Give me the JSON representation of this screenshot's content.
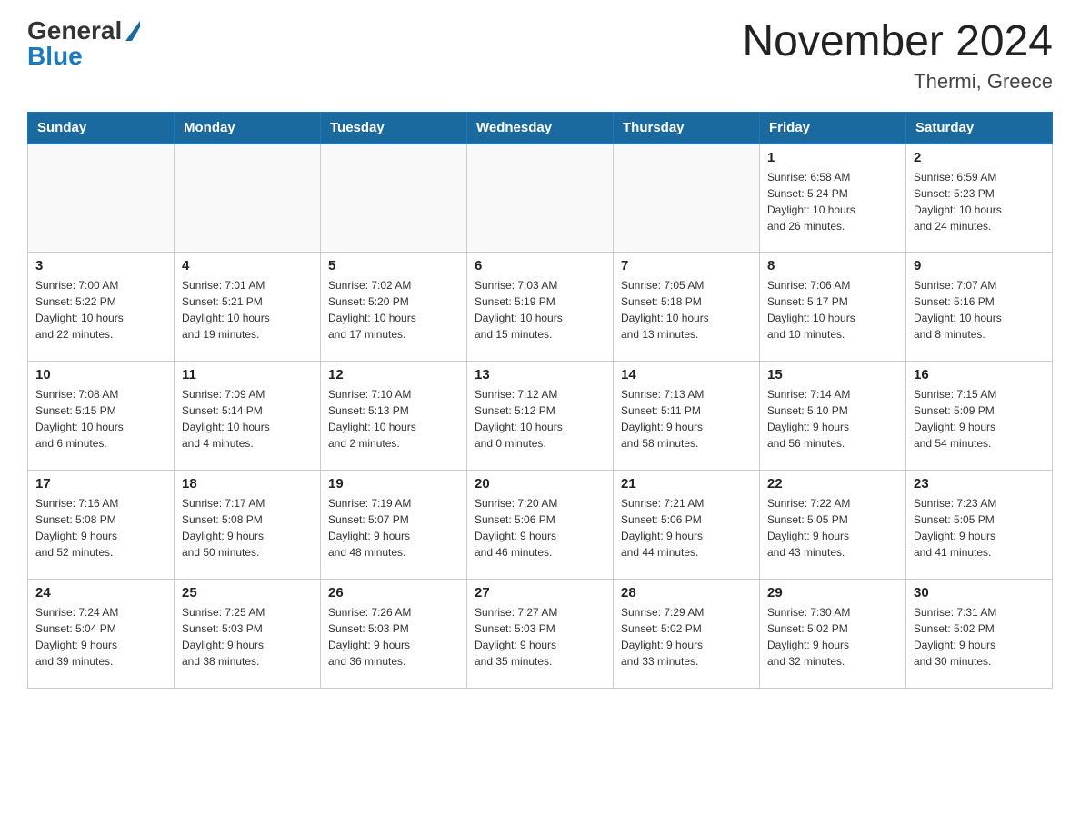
{
  "header": {
    "logo_general": "General",
    "logo_blue": "Blue",
    "month_title": "November 2024",
    "location": "Thermi, Greece"
  },
  "weekdays": [
    "Sunday",
    "Monday",
    "Tuesday",
    "Wednesday",
    "Thursday",
    "Friday",
    "Saturday"
  ],
  "weeks": [
    {
      "days": [
        {
          "num": "",
          "info": ""
        },
        {
          "num": "",
          "info": ""
        },
        {
          "num": "",
          "info": ""
        },
        {
          "num": "",
          "info": ""
        },
        {
          "num": "",
          "info": ""
        },
        {
          "num": "1",
          "info": "Sunrise: 6:58 AM\nSunset: 5:24 PM\nDaylight: 10 hours\nand 26 minutes."
        },
        {
          "num": "2",
          "info": "Sunrise: 6:59 AM\nSunset: 5:23 PM\nDaylight: 10 hours\nand 24 minutes."
        }
      ]
    },
    {
      "days": [
        {
          "num": "3",
          "info": "Sunrise: 7:00 AM\nSunset: 5:22 PM\nDaylight: 10 hours\nand 22 minutes."
        },
        {
          "num": "4",
          "info": "Sunrise: 7:01 AM\nSunset: 5:21 PM\nDaylight: 10 hours\nand 19 minutes."
        },
        {
          "num": "5",
          "info": "Sunrise: 7:02 AM\nSunset: 5:20 PM\nDaylight: 10 hours\nand 17 minutes."
        },
        {
          "num": "6",
          "info": "Sunrise: 7:03 AM\nSunset: 5:19 PM\nDaylight: 10 hours\nand 15 minutes."
        },
        {
          "num": "7",
          "info": "Sunrise: 7:05 AM\nSunset: 5:18 PM\nDaylight: 10 hours\nand 13 minutes."
        },
        {
          "num": "8",
          "info": "Sunrise: 7:06 AM\nSunset: 5:17 PM\nDaylight: 10 hours\nand 10 minutes."
        },
        {
          "num": "9",
          "info": "Sunrise: 7:07 AM\nSunset: 5:16 PM\nDaylight: 10 hours\nand 8 minutes."
        }
      ]
    },
    {
      "days": [
        {
          "num": "10",
          "info": "Sunrise: 7:08 AM\nSunset: 5:15 PM\nDaylight: 10 hours\nand 6 minutes."
        },
        {
          "num": "11",
          "info": "Sunrise: 7:09 AM\nSunset: 5:14 PM\nDaylight: 10 hours\nand 4 minutes."
        },
        {
          "num": "12",
          "info": "Sunrise: 7:10 AM\nSunset: 5:13 PM\nDaylight: 10 hours\nand 2 minutes."
        },
        {
          "num": "13",
          "info": "Sunrise: 7:12 AM\nSunset: 5:12 PM\nDaylight: 10 hours\nand 0 minutes."
        },
        {
          "num": "14",
          "info": "Sunrise: 7:13 AM\nSunset: 5:11 PM\nDaylight: 9 hours\nand 58 minutes."
        },
        {
          "num": "15",
          "info": "Sunrise: 7:14 AM\nSunset: 5:10 PM\nDaylight: 9 hours\nand 56 minutes."
        },
        {
          "num": "16",
          "info": "Sunrise: 7:15 AM\nSunset: 5:09 PM\nDaylight: 9 hours\nand 54 minutes."
        }
      ]
    },
    {
      "days": [
        {
          "num": "17",
          "info": "Sunrise: 7:16 AM\nSunset: 5:08 PM\nDaylight: 9 hours\nand 52 minutes."
        },
        {
          "num": "18",
          "info": "Sunrise: 7:17 AM\nSunset: 5:08 PM\nDaylight: 9 hours\nand 50 minutes."
        },
        {
          "num": "19",
          "info": "Sunrise: 7:19 AM\nSunset: 5:07 PM\nDaylight: 9 hours\nand 48 minutes."
        },
        {
          "num": "20",
          "info": "Sunrise: 7:20 AM\nSunset: 5:06 PM\nDaylight: 9 hours\nand 46 minutes."
        },
        {
          "num": "21",
          "info": "Sunrise: 7:21 AM\nSunset: 5:06 PM\nDaylight: 9 hours\nand 44 minutes."
        },
        {
          "num": "22",
          "info": "Sunrise: 7:22 AM\nSunset: 5:05 PM\nDaylight: 9 hours\nand 43 minutes."
        },
        {
          "num": "23",
          "info": "Sunrise: 7:23 AM\nSunset: 5:05 PM\nDaylight: 9 hours\nand 41 minutes."
        }
      ]
    },
    {
      "days": [
        {
          "num": "24",
          "info": "Sunrise: 7:24 AM\nSunset: 5:04 PM\nDaylight: 9 hours\nand 39 minutes."
        },
        {
          "num": "25",
          "info": "Sunrise: 7:25 AM\nSunset: 5:03 PM\nDaylight: 9 hours\nand 38 minutes."
        },
        {
          "num": "26",
          "info": "Sunrise: 7:26 AM\nSunset: 5:03 PM\nDaylight: 9 hours\nand 36 minutes."
        },
        {
          "num": "27",
          "info": "Sunrise: 7:27 AM\nSunset: 5:03 PM\nDaylight: 9 hours\nand 35 minutes."
        },
        {
          "num": "28",
          "info": "Sunrise: 7:29 AM\nSunset: 5:02 PM\nDaylight: 9 hours\nand 33 minutes."
        },
        {
          "num": "29",
          "info": "Sunrise: 7:30 AM\nSunset: 5:02 PM\nDaylight: 9 hours\nand 32 minutes."
        },
        {
          "num": "30",
          "info": "Sunrise: 7:31 AM\nSunset: 5:02 PM\nDaylight: 9 hours\nand 30 minutes."
        }
      ]
    }
  ]
}
